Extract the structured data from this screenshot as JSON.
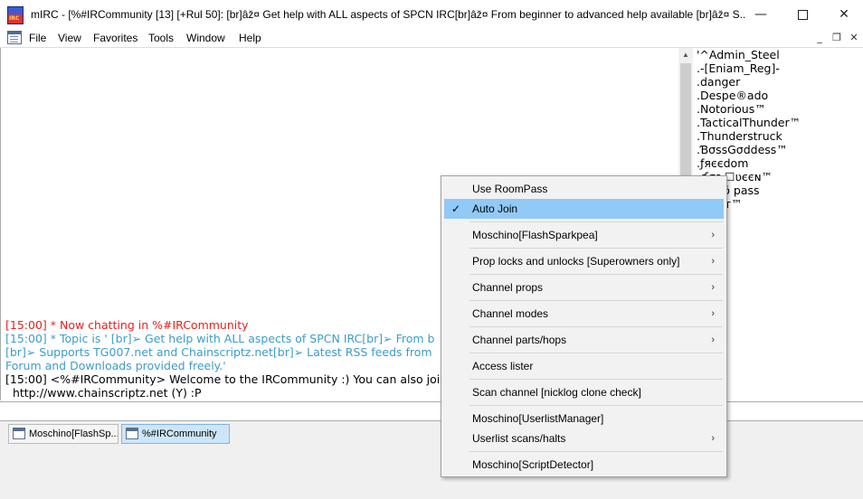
{
  "window": {
    "title": "mIRC - [%#IRCommunity [13] [+Rul 50]:  [br]âž¤ Get help with ALL aspects of SPCN IRC[br]âž¤ From beginner to advanced help available [br]âž¤ S...",
    "controls": {
      "minimize": "—",
      "maximize": "",
      "close": "✕"
    }
  },
  "menubar": {
    "items": [
      "File",
      "View",
      "Favorites",
      "Tools",
      "Window",
      "Help"
    ],
    "mdi": {
      "minimize": "_",
      "restore": "❐",
      "close": "✕"
    }
  },
  "chat": {
    "lines": [
      {
        "text": "[15:00] * Now chatting in %#IRCommunity",
        "color": "#e8201b"
      },
      {
        "text": "[15:00] * Topic is ' [br]➢ Get help with ALL aspects of SPCN IRC[br]➢ From b",
        "color": "#3b9dc9"
      },
      {
        "text": "[br]➢ Supports TG007.net and Chainscriptz.net[br]➢ Latest RSS feeds from",
        "color": "#3b9dc9"
      },
      {
        "text": "Forum and Downloads provided freely.'",
        "color": "#3b9dc9"
      },
      {
        "text": "[15:00] <%#IRCommunity> Welcome to the IRCommunity :) You can also joi",
        "color": "#000000"
      },
      {
        "text": "  http://www.chainscriptz.net (Y) :P",
        "color": "#000000"
      }
    ]
  },
  "nicklist": [
    "'^Admin_Steel",
    ".-[Eniam_Reg]-",
    ".danger",
    ".Despe®ado",
    ".Notorious™",
    ".TacticalThunder™",
    ".Thunderstruck",
    ".ƁσѕѕGσddess™",
    ".ƒяєєdom",
    ".ʛσѕ ☐ʋєєɴ™",
    "     Hõ pass",
    "     ʌíт™"
  ],
  "scrollbar": {
    "up_arrow": "▲"
  },
  "switchbar": {
    "buttons": [
      {
        "label": "Moschino[FlashSp...",
        "active": false
      },
      {
        "label": "%#IRCommunity",
        "active": true
      }
    ]
  },
  "context_menu": {
    "items": [
      {
        "label": "Use RoomPass",
        "checked": false,
        "submenu": false,
        "highlighted": false
      },
      {
        "label": "Auto Join",
        "checked": true,
        "submenu": false,
        "highlighted": true
      },
      {
        "label": "Moschino[FlashSparkpea]",
        "checked": false,
        "submenu": true,
        "highlighted": false
      },
      {
        "label": "Prop locks and unlocks [Superowners only]",
        "checked": false,
        "submenu": true,
        "highlighted": false
      },
      {
        "label": "Channel props",
        "checked": false,
        "submenu": true,
        "highlighted": false
      },
      {
        "label": "Channel modes",
        "checked": false,
        "submenu": true,
        "highlighted": false
      },
      {
        "label": "Channel parts/hops",
        "checked": false,
        "submenu": true,
        "highlighted": false
      },
      {
        "label": "Access lister",
        "checked": false,
        "submenu": false,
        "highlighted": false
      },
      {
        "label": "Scan channel [nicklog clone check]",
        "checked": false,
        "submenu": false,
        "highlighted": false
      },
      {
        "label": "Moschino[UserlistManager]",
        "checked": false,
        "submenu": false,
        "highlighted": false
      },
      {
        "label": "Userlist scans/halts",
        "checked": false,
        "submenu": true,
        "highlighted": false
      },
      {
        "label": "Moschino[ScriptDetector]",
        "checked": false,
        "submenu": false,
        "highlighted": false
      }
    ],
    "check_glyph": "✓",
    "submenu_glyph": "›"
  }
}
